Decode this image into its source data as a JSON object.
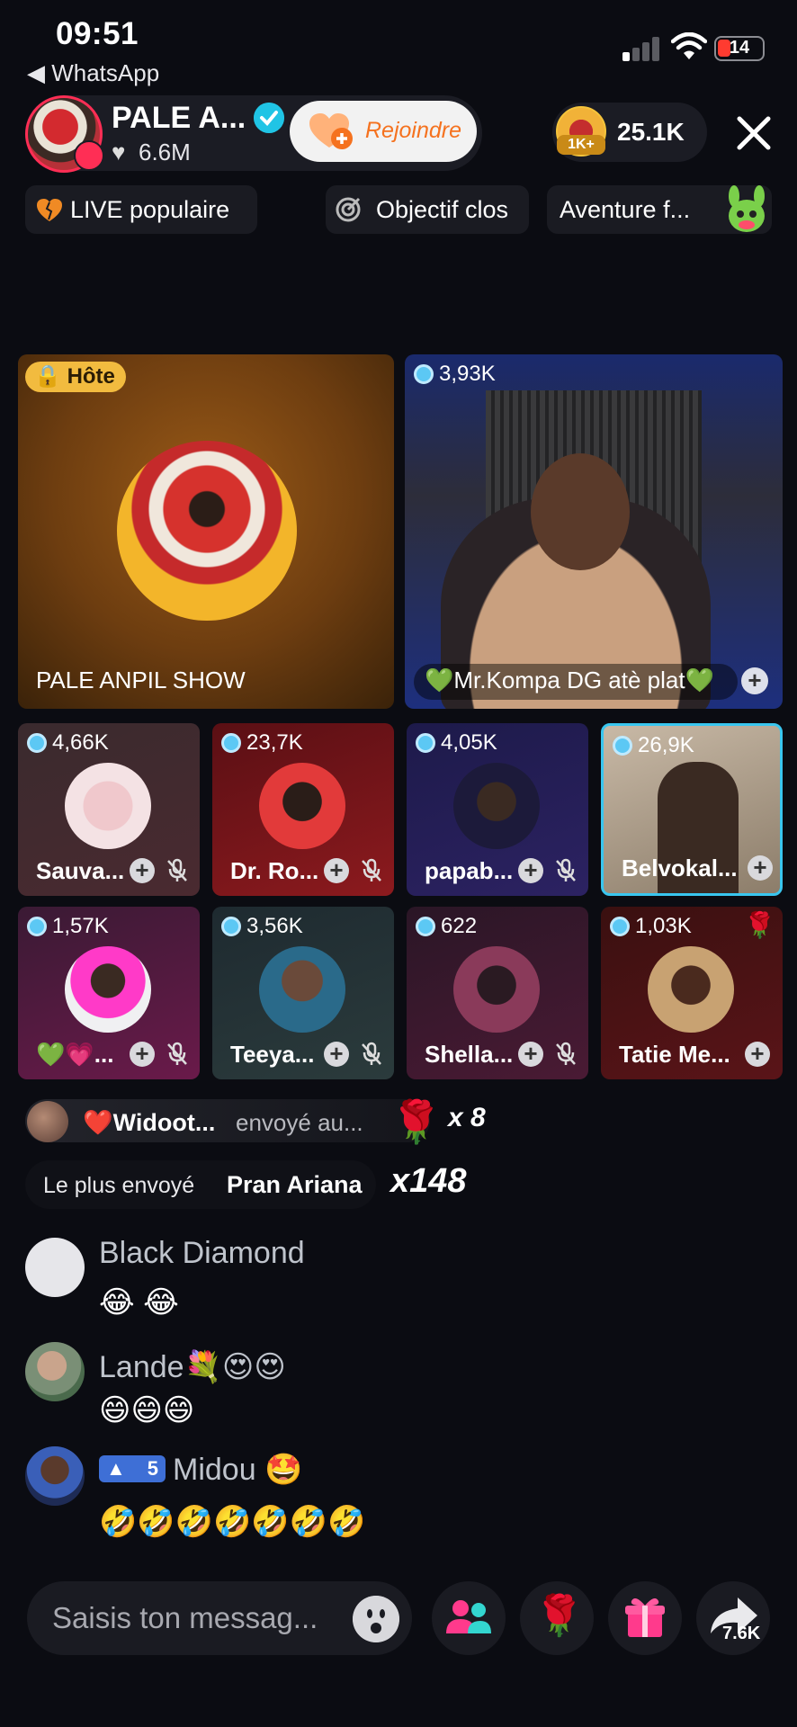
{
  "status_bar": {
    "time": "09:51",
    "back_app": "◀ WhatsApp",
    "battery_level": "14"
  },
  "header": {
    "host_name": "PALE A...",
    "host_likes": "6.6M",
    "join_label": "Rejoindre",
    "viewer_badge": "1K+",
    "viewer_count": "25.1K"
  },
  "chips": {
    "live_popular": "LIVE populaire",
    "goal": "Objectif clos",
    "adventure": "Aventure f..."
  },
  "grid": {
    "host_tag": "Hôte",
    "host_title": "PALE ANPIL SHOW",
    "featured": {
      "count": "3,93K",
      "name": "💚Mr.Kompa DG atè plat💚"
    },
    "guests": [
      {
        "count": "4,66K",
        "name": "Sauva..."
      },
      {
        "count": "23,7K",
        "name": "Dr. Ro..."
      },
      {
        "count": "4,05K",
        "name": "papab..."
      },
      {
        "count": "26,9K",
        "name": "Belvokal..."
      },
      {
        "count": "1,57K",
        "name": "💚💗..."
      },
      {
        "count": "3,56K",
        "name": "Teeya..."
      },
      {
        "count": "622",
        "name": "Shella..."
      },
      {
        "count": "1,03K",
        "name": "Tatie Me..."
      }
    ]
  },
  "gift": {
    "user": "❤️Widoot...",
    "action": "envoyé au...",
    "icon": "🌹",
    "multiplier": "x 8",
    "top_label": "Le plus envoyé",
    "top_name": "Pran Ariana",
    "top_multiplier": "x148"
  },
  "comments": [
    {
      "name": "Black Diamond",
      "text": "😂 😂"
    },
    {
      "name": "Lande💐😍😍",
      "text": "😄😄😄"
    },
    {
      "name": "Midou 🤩",
      "level": "5",
      "text": "🤣🤣🤣🤣🤣🤣🤣"
    }
  ],
  "bottom": {
    "placeholder": "Saisis ton messag...",
    "rose": "🌹",
    "share_count": "7.6K"
  },
  "colors": {
    "background": "#0b0c12",
    "accent_orange": "#f5721f",
    "live_red": "#ff2e55",
    "verified_blue": "#20c4e5",
    "host_tag_yellow": "#f2bb3f",
    "highlight_border": "#39c6ef"
  }
}
